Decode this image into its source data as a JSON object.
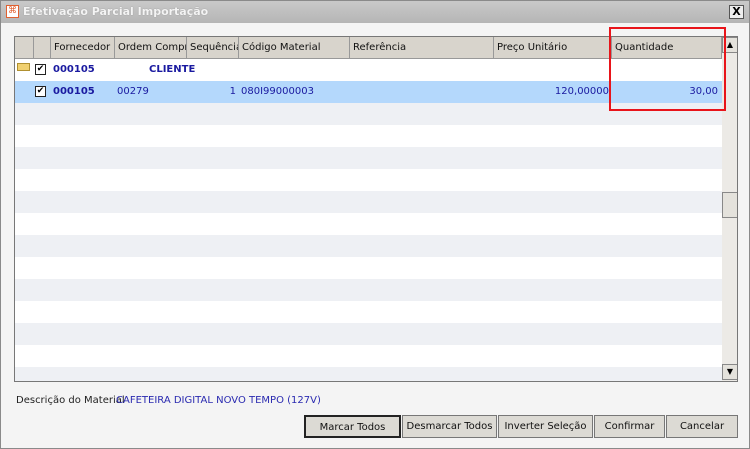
{
  "window": {
    "title": "Efetivação Parcial Importação",
    "close_label": "X"
  },
  "grid": {
    "columns": [
      "Fornecedor",
      "Ordem Compra",
      "Sequência",
      "Código Material",
      "Referência",
      "Preço Unitário",
      "Quantidade"
    ],
    "group": {
      "fornecedor": "000105",
      "name": "CLIENTE",
      "checked": "✔"
    },
    "rows": [
      {
        "checked": "✔",
        "fornecedor": "000105",
        "ordem_compra": "00279",
        "sequencia": "1",
        "codigo_material": "080I99000003",
        "referencia": "",
        "preco_unitario": "120,00000",
        "quantidade": "30,00"
      }
    ]
  },
  "description": {
    "label": "Descrição do Material",
    "value": "CAFETEIRA DIGITAL NOVO TEMPO (127V)"
  },
  "buttons": {
    "mark_all": "Marcar Todos",
    "unmark_all": "Desmarcar Todos",
    "invert": "Inverter Seleção",
    "confirm": "Confirmar",
    "cancel": "Cancelar"
  }
}
